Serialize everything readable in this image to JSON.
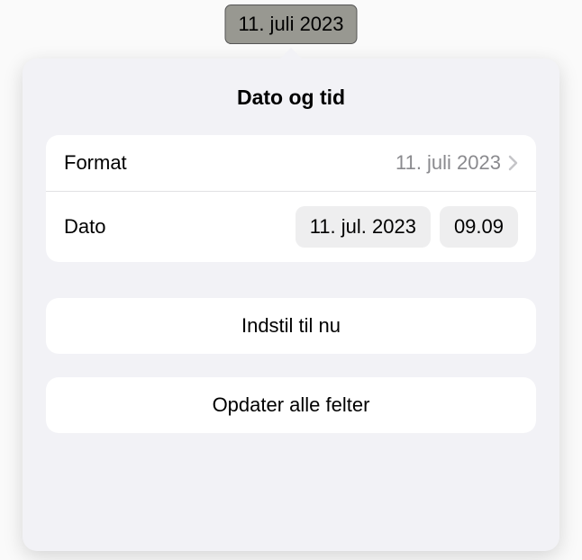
{
  "chip": {
    "text": "11. juli 2023"
  },
  "popover": {
    "title": "Dato og tid",
    "format": {
      "label": "Format",
      "value": "11. juli 2023"
    },
    "date": {
      "label": "Dato",
      "dateValue": "11. jul. 2023",
      "timeValue": "09.09"
    },
    "setNow": {
      "label": "Indstil til nu"
    },
    "updateAll": {
      "label": "Opdater alle felter"
    }
  }
}
